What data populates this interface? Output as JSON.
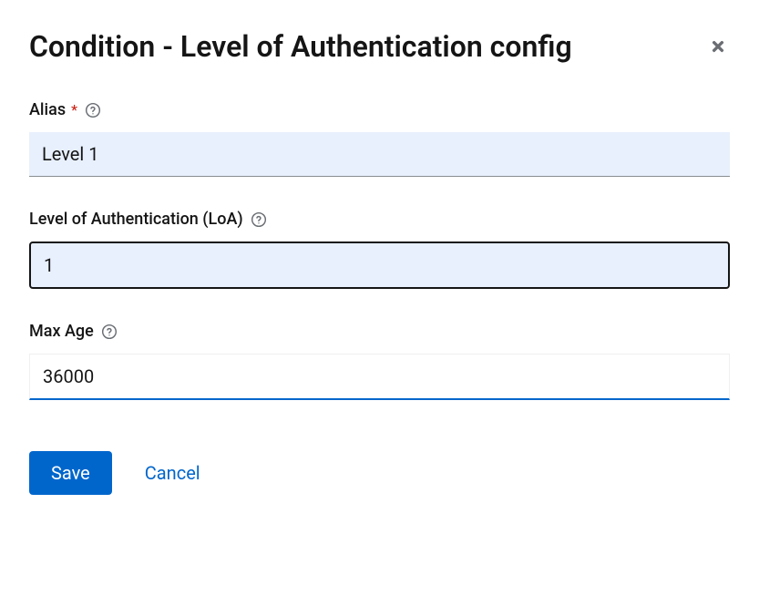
{
  "header": {
    "title": "Condition - Level of Authentication config"
  },
  "fields": {
    "alias": {
      "label": "Alias",
      "required": true,
      "value": "Level 1"
    },
    "loa": {
      "label": "Level of Authentication (LoA)",
      "required": false,
      "value": "1"
    },
    "maxAge": {
      "label": "Max Age",
      "required": false,
      "value": "36000"
    }
  },
  "buttons": {
    "save": "Save",
    "cancel": "Cancel"
  }
}
